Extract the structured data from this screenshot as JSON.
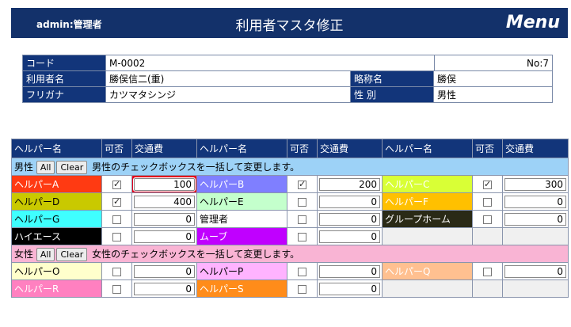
{
  "header": {
    "user": "admin:管理者",
    "title": "利用者マスタ修正",
    "menu": "Menu"
  },
  "info": {
    "code_label": "コード",
    "code": "M-0002",
    "no": "No:7",
    "name_label": "利用者名",
    "name": "勝俣信二(重)",
    "short_label": "略称名",
    "short": "勝俣",
    "kana_label": "フリガナ",
    "kana": "カツマタシンジ",
    "sex_label": "性 別",
    "sex": "男性"
  },
  "grid_headers": [
    "ヘルパー名",
    "可否",
    "交通費",
    "ヘルパー名",
    "可否",
    "交通費",
    "ヘルパー名",
    "可否",
    "交通費"
  ],
  "male_section": {
    "label": "男性",
    "all": "All",
    "clear": "Clear",
    "note": "男性のチェックボックスを一括して変更します。"
  },
  "female_section": {
    "label": "女性",
    "all": "All",
    "clear": "Clear",
    "note": "女性のチェックボックスを一括して変更します。"
  },
  "colors": {
    "header_bg": "#13316a",
    "male_bg": "#9dd2f7",
    "female_bg": "#f9b4d4",
    "highlight": "#e3001b"
  },
  "male_rows": [
    [
      {
        "name": "ヘルパーA",
        "color": "#ff3a12",
        "text": "#ffffff",
        "checked": true,
        "fare": "100",
        "hl": true
      },
      {
        "name": "ヘルパーB",
        "color": "#7f7fff",
        "text": "#ffffff",
        "checked": true,
        "fare": "200"
      },
      {
        "name": "ヘルパーC",
        "color": "#d9ff36",
        "text": "#ffffff",
        "checked": true,
        "fare": "300"
      }
    ],
    [
      {
        "name": "ヘルパーD",
        "color": "#c9c900",
        "text": "#000000",
        "checked": true,
        "fare": "400"
      },
      {
        "name": "ヘルパーE",
        "color": "#c4ffcc",
        "text": "#000000",
        "checked": false,
        "fare": "0"
      },
      {
        "name": "ヘルパーF",
        "color": "#ffc000",
        "text": "#ffffff",
        "checked": false,
        "fare": "0"
      }
    ],
    [
      {
        "name": "ヘルパーG",
        "color": "#3fffff",
        "text": "#000000",
        "checked": false,
        "fare": "0"
      },
      {
        "name": "管理者",
        "color": "#ffffff",
        "text": "#000000",
        "checked": false,
        "fare": "0"
      },
      {
        "name": "グループホーム",
        "color": "#2a2a16",
        "text": "#ffffff",
        "checked": false,
        "fare": "0"
      }
    ],
    [
      {
        "name": "ハイエース",
        "color": "#000000",
        "text": "#ffffff",
        "checked": false,
        "fare": "0"
      },
      {
        "name": "ムーブ",
        "color": "#c000ff",
        "text": "#ffffff",
        "checked": false,
        "fare": "0"
      },
      null
    ]
  ],
  "female_rows": [
    [
      {
        "name": "ヘルパーO",
        "color": "#ffffcc",
        "text": "#000000",
        "checked": false,
        "fare": "0"
      },
      {
        "name": "ヘルパーP",
        "color": "#ffb3ff",
        "text": "#000000",
        "checked": false,
        "fare": "0"
      },
      {
        "name": "ヘルパーQ",
        "color": "#ffc090",
        "text": "#ffffff",
        "checked": false,
        "fare": "0"
      }
    ],
    [
      {
        "name": "ヘルパーR",
        "color": "#ff80c0",
        "text": "#ffffff",
        "checked": false,
        "fare": "0"
      },
      {
        "name": "ヘルパーS",
        "color": "#ff8c1a",
        "text": "#ffffff",
        "checked": false,
        "fare": "0"
      },
      null
    ]
  ]
}
